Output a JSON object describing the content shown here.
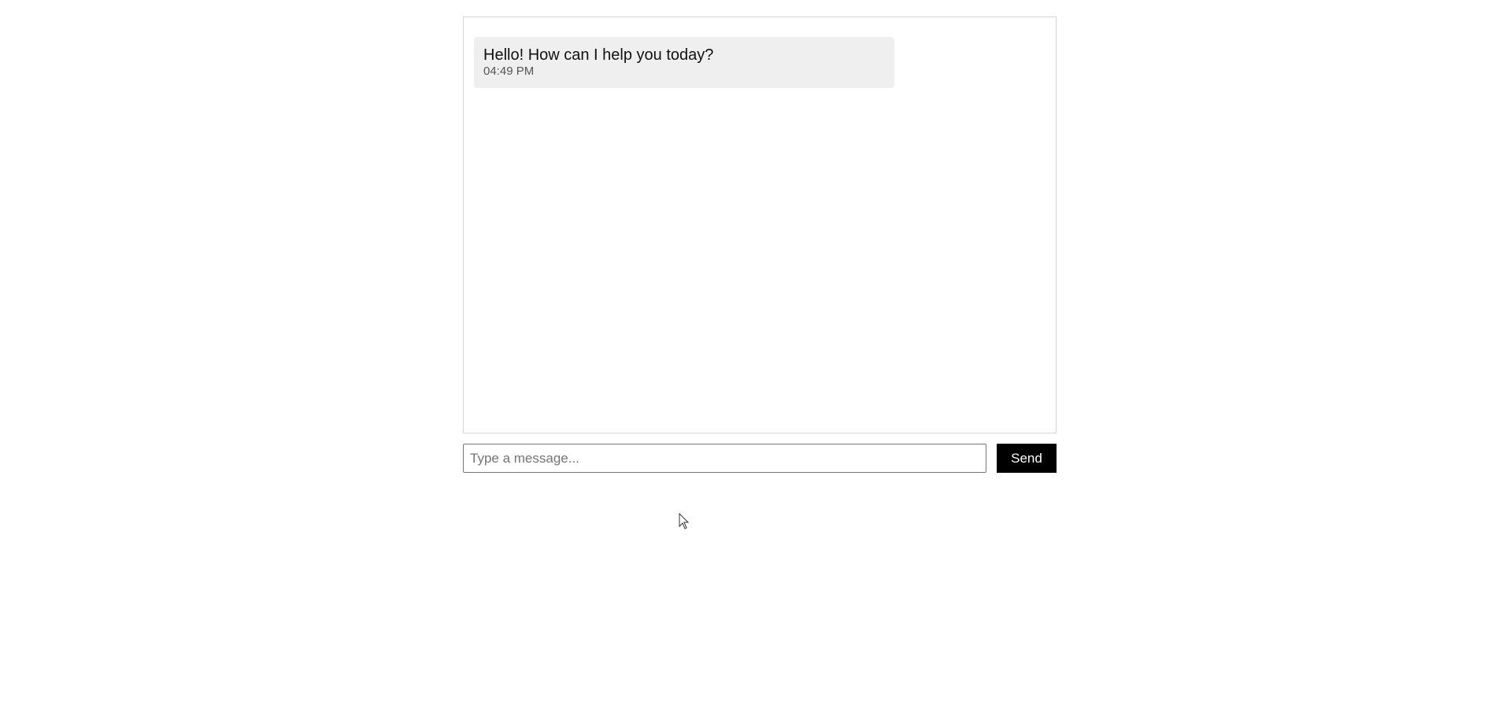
{
  "chat": {
    "messages": [
      {
        "text": "Hello! How can I help you today?",
        "time": "04:49 PM"
      }
    ]
  },
  "composer": {
    "input_value": "",
    "input_placeholder": "Type a message...",
    "send_label": "Send"
  },
  "colors": {
    "send_button_bg": "#000000",
    "send_button_text": "#ffffff",
    "message_bubble_bg": "#efefef",
    "border": "#d6d6d6"
  },
  "icons": {
    "cursor": "mouse-pointer-icon"
  }
}
